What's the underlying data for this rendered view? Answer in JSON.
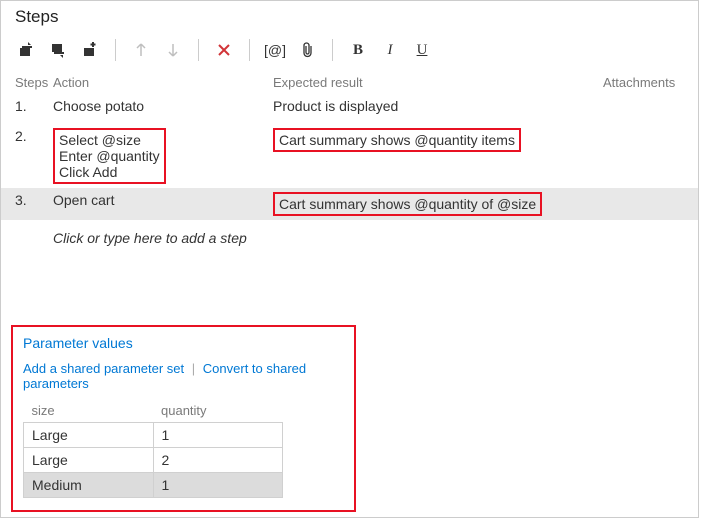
{
  "title": "Steps",
  "toolbar": {
    "bold": "B",
    "italic": "I",
    "underline": "U"
  },
  "headers": {
    "steps": "Steps",
    "action": "Action",
    "expected": "Expected result",
    "attachments": "Attachments"
  },
  "rows": [
    {
      "num": "1.",
      "action": "Choose potato",
      "expected": "Product is displayed",
      "hl": false,
      "selected": false
    },
    {
      "num": "2.",
      "action": "Select @size\nEnter @quantity\nClick Add",
      "expected": "Cart summary shows @quantity items",
      "hl": true,
      "selected": false
    },
    {
      "num": "3.",
      "action": "Open cart",
      "expected": "Cart summary shows @quantity of @size",
      "hl": true,
      "selected": true,
      "hl_expected_only": true
    }
  ],
  "placeholder": "Click or type here to add a step",
  "params": {
    "title": "Parameter values",
    "link_add": "Add a shared parameter set",
    "link_convert": "Convert to shared parameters",
    "cols": {
      "size": "size",
      "quantity": "quantity"
    },
    "data": [
      {
        "size": "Large",
        "quantity": "1",
        "selected": false
      },
      {
        "size": "Large",
        "quantity": "2",
        "selected": false
      },
      {
        "size": "Medium",
        "quantity": "1",
        "selected": true
      }
    ]
  }
}
